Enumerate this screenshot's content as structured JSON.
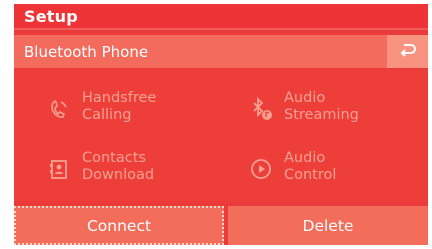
{
  "header": {
    "title": "Setup"
  },
  "subheader": {
    "label": "Bluetooth Phone",
    "back_icon": "back-arrow-icon"
  },
  "features": [
    {
      "label": "Handsfree\nCalling",
      "icon": "handsfree-phone-icon"
    },
    {
      "label": "Audio\nStreaming",
      "icon": "bluetooth-audio-icon"
    },
    {
      "label": "Contacts\nDownload",
      "icon": "contacts-download-icon"
    },
    {
      "label": "Audio\nControl",
      "icon": "play-circle-icon"
    }
  ],
  "buttons": {
    "connect": "Connect",
    "delete": "Delete"
  },
  "colors": {
    "background": "#ea3a3a",
    "subbar": "#f26b5c",
    "disabled_text": "#f7a08f",
    "button": "#f26d5a"
  }
}
